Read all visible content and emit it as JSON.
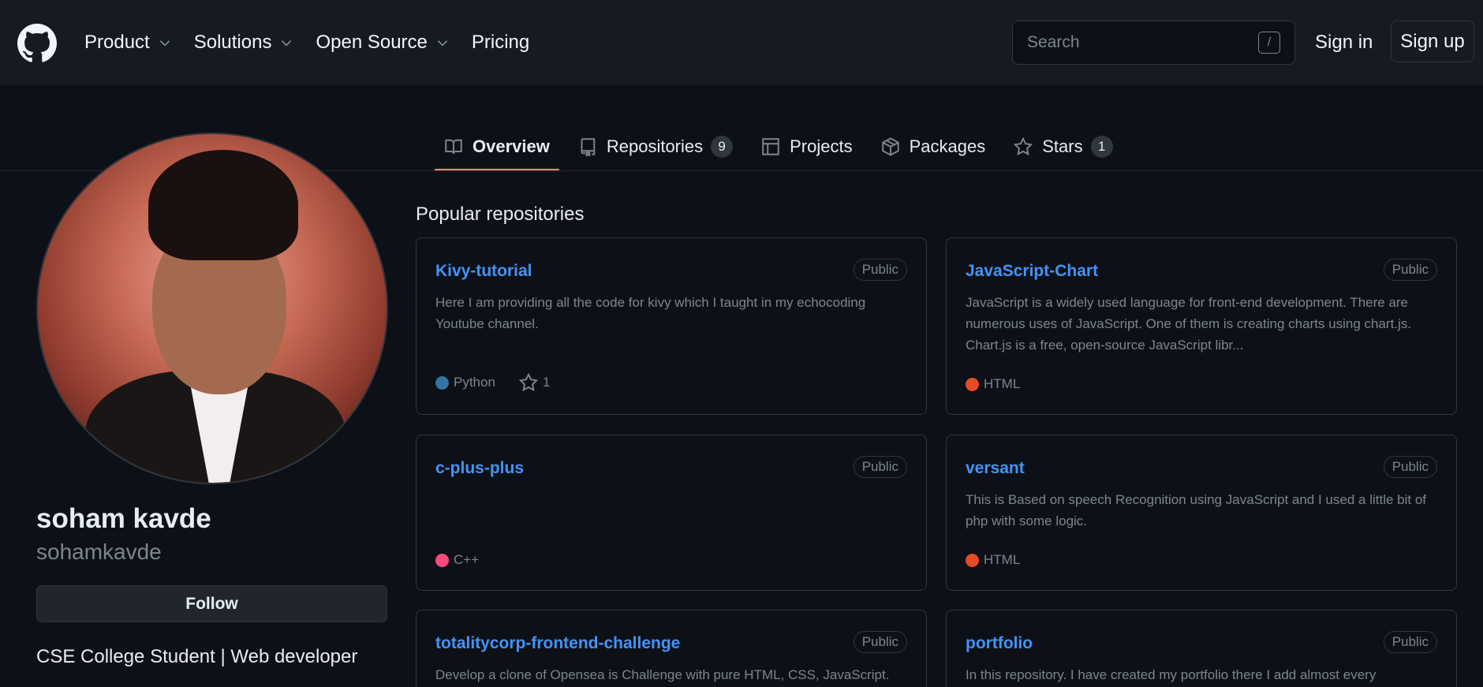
{
  "nav": {
    "items": [
      {
        "label": "Product",
        "has_menu": true
      },
      {
        "label": "Solutions",
        "has_menu": true
      },
      {
        "label": "Open Source",
        "has_menu": true
      },
      {
        "label": "Pricing",
        "has_menu": false
      }
    ],
    "search_placeholder": "Search",
    "search_shortcut": "/",
    "sign_in": "Sign in",
    "sign_up": "Sign up"
  },
  "tabs": [
    {
      "label": "Overview",
      "icon": "book-icon",
      "active": true
    },
    {
      "label": "Repositories",
      "icon": "repo-icon",
      "count": "9"
    },
    {
      "label": "Projects",
      "icon": "table-icon"
    },
    {
      "label": "Packages",
      "icon": "package-icon"
    },
    {
      "label": "Stars",
      "icon": "star-icon",
      "count": "1"
    }
  ],
  "profile": {
    "display_name": "soham kavde",
    "username": "sohamkavde",
    "follow_label": "Follow",
    "bio": "CSE College Student | Web developer"
  },
  "popular": {
    "title": "Popular repositories",
    "repos": [
      {
        "name": "Kivy-tutorial",
        "visibility": "Public",
        "description": "Here I am providing all the code for kivy which I taught in my echocoding Youtube channel.",
        "language": "Python",
        "lang_color": "#3572A5",
        "stars": "1"
      },
      {
        "name": "JavaScript-Chart",
        "visibility": "Public",
        "description": "JavaScript is a widely used language for front-end development. There are numerous uses of JavaScript. One of them is creating charts using chart.js. Chart.js is a free, open-source JavaScript libr...",
        "language": "HTML",
        "lang_color": "#e34c26"
      },
      {
        "name": "c-plus-plus",
        "visibility": "Public",
        "description": "",
        "language": "C++",
        "lang_color": "#f34b7d"
      },
      {
        "name": "versant",
        "visibility": "Public",
        "description": "This is Based on speech Recognition using JavaScript and I used a little bit of php with some logic.",
        "language": "HTML",
        "lang_color": "#e34c26"
      },
      {
        "name": "totalitycorp-frontend-challenge",
        "visibility": "Public",
        "description": "Develop a clone of Opensea is Challenge with pure HTML, CSS, JavaScript."
      },
      {
        "name": "portfolio",
        "visibility": "Public",
        "description": "In this repository. I have created my portfolio there I add almost every"
      }
    ]
  },
  "colors": {
    "accent": "#fd8c73",
    "link": "#4493f8",
    "bg": "#0d1117",
    "header_bg": "#161b22"
  }
}
